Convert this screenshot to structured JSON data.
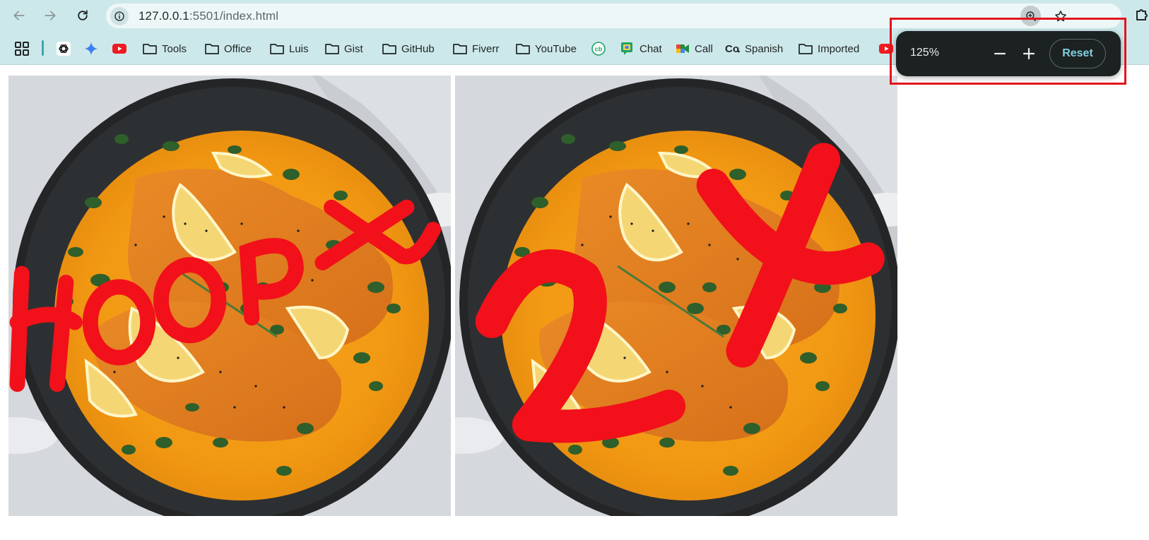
{
  "browser": {
    "url_host": "127.0.0.1",
    "url_path": ":5501/index.html",
    "icons": {
      "back": "arrow-left-icon",
      "forward": "arrow-right-icon",
      "reload": "reload-icon",
      "site_info": "info-icon",
      "zoom": "zoom-in-icon",
      "bookmark": "star-icon",
      "extensions": "puzzle-icon"
    }
  },
  "bookmarks": [
    {
      "label": "",
      "icon": "openai-icon"
    },
    {
      "label": "",
      "icon": "gemini-icon"
    },
    {
      "label": "",
      "icon": "youtube-icon"
    },
    {
      "label": "Tools",
      "icon": "folder-icon"
    },
    {
      "label": "Office",
      "icon": "folder-icon"
    },
    {
      "label": "Luis",
      "icon": "folder-icon"
    },
    {
      "label": "Gist",
      "icon": "folder-icon"
    },
    {
      "label": "GitHub",
      "icon": "folder-icon"
    },
    {
      "label": "Fiverr",
      "icon": "folder-icon"
    },
    {
      "label": "YouTube",
      "icon": "folder-icon"
    },
    {
      "label": "",
      "icon": "cb-icon"
    },
    {
      "label": "Chat",
      "icon": "google-chat-icon"
    },
    {
      "label": "Call",
      "icon": "google-meet-icon"
    },
    {
      "label": "Spanish",
      "icon": "co-icon"
    },
    {
      "label": "Imported",
      "icon": "folder-icon"
    },
    {
      "label": "",
      "icon": "youtube-icon"
    }
  ],
  "content": {
    "images": [
      {
        "annotation": "400px",
        "alt": "salmon in orange curry in a black skillet"
      },
      {
        "annotation": "2x",
        "alt": "salmon in orange curry in a black skillet"
      }
    ]
  },
  "zoom_popup": {
    "level": "125%",
    "reset_label": "Reset",
    "colors": {
      "highlight": "#e3141d",
      "accent": "#7fd0e0"
    }
  }
}
